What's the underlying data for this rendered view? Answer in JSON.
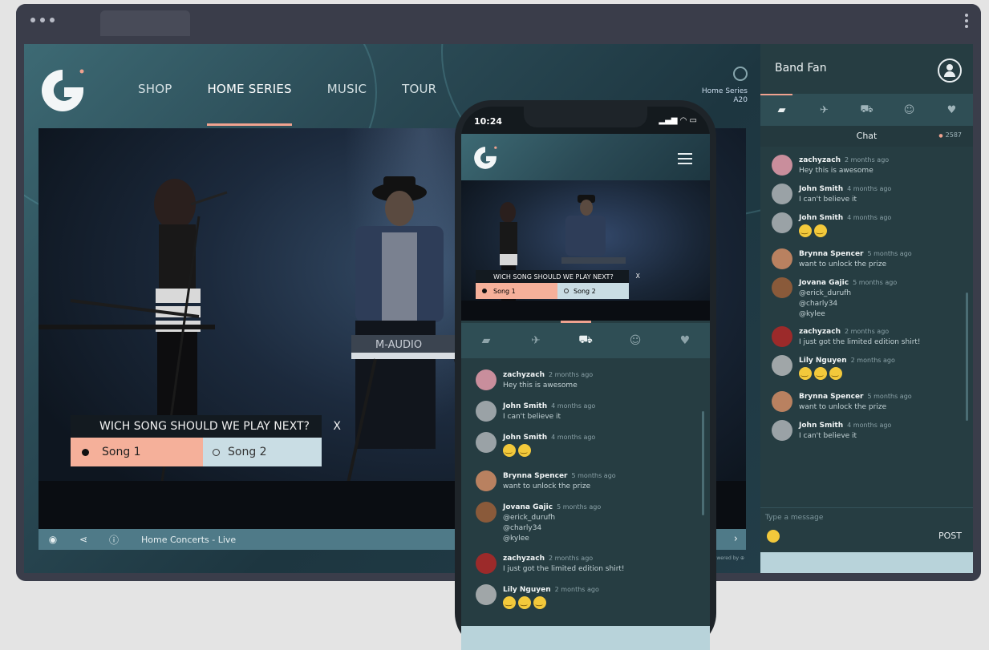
{
  "browser": {
    "nav": [
      "SHOP",
      "HOME SERIES",
      "MUSIC",
      "TOUR"
    ],
    "series_line1": "Home Series",
    "series_line2": "A20",
    "poll": {
      "question": "WICH SONG SHOULD WE PLAY NEXT?",
      "close": "X",
      "option1": "Song 1",
      "option2": "Song 2"
    },
    "keyboard_brand": "M-AUDIO",
    "control_bar": {
      "title": "Home Concerts - Live",
      "next": "›"
    },
    "powered": "Powered by ⊕"
  },
  "sidebar": {
    "title": "Band Fan",
    "chat_label": "Chat",
    "count": "2587",
    "input_placeholder": "Type a message",
    "post_label": "POST",
    "messages": [
      {
        "name": "zachyzach",
        "time": "2 months ago",
        "lines": [
          "Hey this is awesome"
        ],
        "avatar": "#c98e9c"
      },
      {
        "name": "John Smith",
        "time": "4 months ago",
        "lines": [
          "I can't believe it"
        ],
        "avatar": "#9aa2a6"
      },
      {
        "name": "John Smith",
        "time": "4 months ago",
        "lines": [],
        "emojis": 2,
        "avatar": "#9aa2a6"
      },
      {
        "name": "Brynna Spencer",
        "time": "5 months ago",
        "lines": [
          "want to unlock the prize"
        ],
        "avatar": "#b98160"
      },
      {
        "name": "Jovana Gajic",
        "time": "5 months ago",
        "lines": [
          "@erick_durufh",
          "@charly34",
          "@kylee"
        ],
        "avatar": "#8a5a3a"
      },
      {
        "name": "zachyzach",
        "time": "2 months ago",
        "lines": [
          "I just got the limited edition shirt!"
        ],
        "avatar": "#9c2a2a"
      },
      {
        "name": "Lily Nguyen",
        "time": "2 months ago",
        "lines": [],
        "emojis": 3,
        "avatar": "#a0a6a8"
      },
      {
        "name": "Brynna Spencer",
        "time": "5 months ago",
        "lines": [
          "want to unlock the prize"
        ],
        "avatar": "#b98160"
      },
      {
        "name": "John Smith",
        "time": "4 months ago",
        "lines": [
          "I can't believe it"
        ],
        "avatar": "#9aa2a6"
      }
    ]
  },
  "phone": {
    "time": "10:24",
    "poll": {
      "question": "WICH SONG SHOULD WE PLAY NEXT?",
      "close": "X",
      "option1": "Song 1",
      "option2": "Song 2"
    },
    "messages": [
      {
        "name": "zachyzach",
        "time": "2 months ago",
        "lines": [
          "Hey this is awesome"
        ],
        "avatar": "#c98e9c"
      },
      {
        "name": "John Smith",
        "time": "4 months ago",
        "lines": [
          "I can't believe it"
        ],
        "avatar": "#9aa2a6"
      },
      {
        "name": "John Smith",
        "time": "4 months ago",
        "lines": [],
        "emojis": 2,
        "avatar": "#9aa2a6"
      },
      {
        "name": "Brynna Spencer",
        "time": "5 months ago",
        "lines": [
          "want to unlock the prize"
        ],
        "avatar": "#b98160"
      },
      {
        "name": "Jovana Gajic",
        "time": "5 months ago",
        "lines": [
          "@erick_durufh",
          "@charly34",
          "@kylee"
        ],
        "avatar": "#8a5a3a"
      },
      {
        "name": "zachyzach",
        "time": "2 months ago",
        "lines": [
          "I just got the limited edition shirt!"
        ],
        "avatar": "#9c2a2a"
      },
      {
        "name": "Lily Nguyen",
        "time": "2 months ago",
        "lines": [],
        "emojis": 3,
        "avatar": "#a0a6a8"
      }
    ]
  },
  "colors": {
    "accent": "#f0a28f",
    "panel": "#263d42",
    "option_selected": "#f5b09a",
    "option_unselected": "#c9dde4"
  },
  "icons": {
    "tabs": [
      "chat-icon",
      "twitter-icon",
      "cart-icon",
      "emoji-icon",
      "heart-icon"
    ],
    "controls": [
      "eye-icon",
      "share-icon",
      "info-icon"
    ]
  }
}
